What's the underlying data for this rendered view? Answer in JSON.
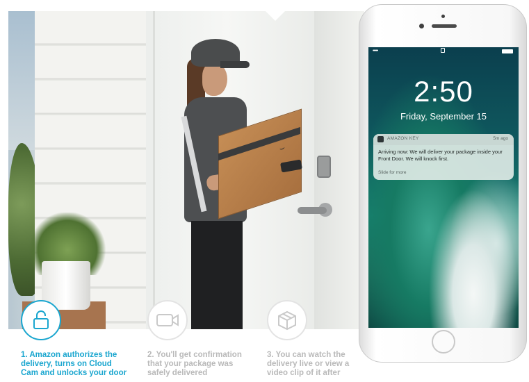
{
  "steps": [
    {
      "text": "1. Amazon authorizes the\ndelivery, turns on Cloud\nCam and unlocks your door",
      "icon": "padlock-open-icon",
      "state": "active"
    },
    {
      "text": "2. You'll get confirmation\nthat your package was\nsafely delivered",
      "icon": "video-camera-icon",
      "state": "inactive"
    },
    {
      "text": "3. You can watch the\ndelivery live or view a\nvideo clip of it after",
      "icon": "package-box-icon",
      "state": "inactive"
    }
  ],
  "phone": {
    "time": "2:50",
    "date": "Friday, September 15",
    "status_signal": "•••••",
    "notification": {
      "app": "AMAZON KEY",
      "ago": "5m ago",
      "body": "Arriving now: We will deliver your package inside your Front Door. We will knock first.",
      "hint": "Slide for more"
    }
  },
  "photo": {
    "box_mark": "⌣"
  },
  "colors": {
    "accent": "#1aa6cf",
    "inactive": "#b9b9b9"
  }
}
